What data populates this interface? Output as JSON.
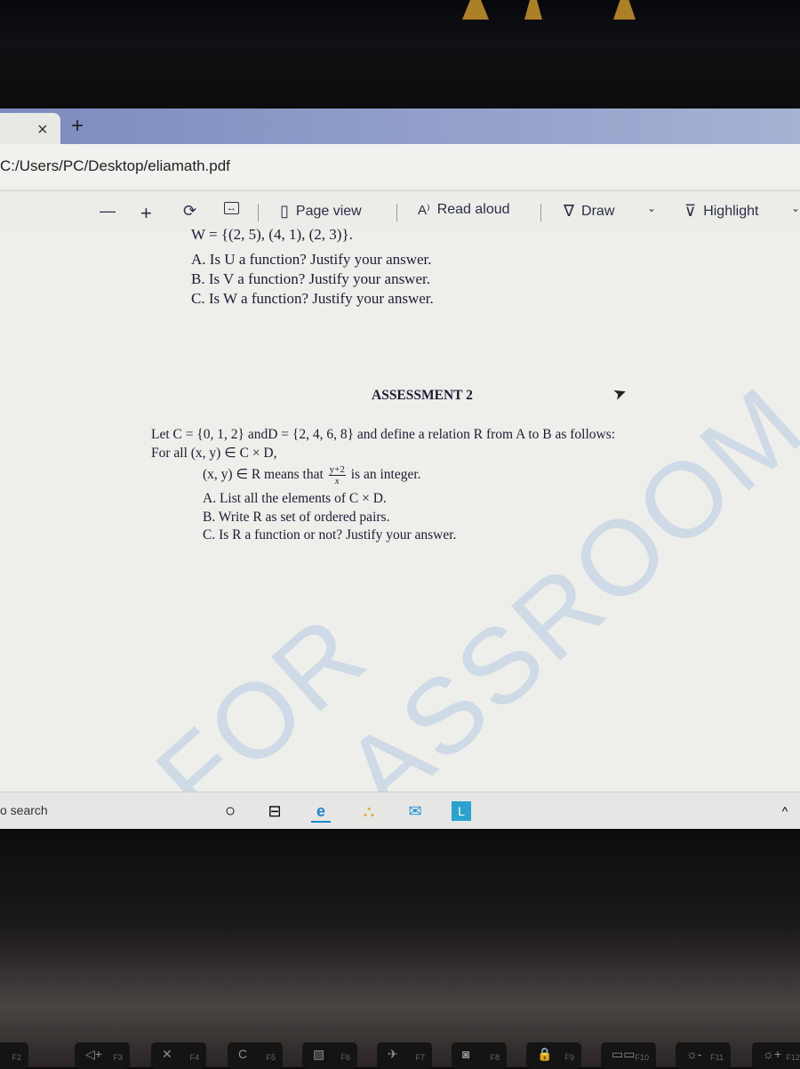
{
  "browser": {
    "tab_close": "×",
    "new_tab": "+",
    "address": "C:/Users/PC/Desktop/eliamath.pdf"
  },
  "toolbar": {
    "zoom_out": "—",
    "zoom_in": "+",
    "rotate_icon": "⟳",
    "fit_icon": "↔",
    "page_view": "Page view",
    "read_aloud": "Read aloud",
    "draw": "Draw",
    "highlight": "Highlight",
    "chevron": "⌄"
  },
  "document": {
    "prev_line": "W = {(2, 5), (4, 1), (2, 3)}.",
    "prev_questions": [
      "A. Is U a function? Justify your answer.",
      "B. Is V a function? Justify your answer.",
      "C. Is W a function? Justify your answer."
    ],
    "heading": "ASSESSMENT 2",
    "intro": "Let C = {0, 1, 2} andD = {2, 4, 6, 8} and define a relation R from A to B as follows:",
    "for_all": "For all (x, y) ∈ C × D,",
    "relation_prefix": "(x, y) ∈ R means that",
    "frac_num": "y+2",
    "frac_den": "x",
    "relation_suffix": "is an integer.",
    "questions": [
      "A. List all the elements of  C × D.",
      "B. Write R as set of ordered pairs.",
      "C. Is R a function or not? Justify your answer."
    ],
    "watermark": "FOR CLASSROOM USE"
  },
  "taskbar": {
    "search": "o search",
    "chevron": "^"
  },
  "keyboard": [
    {
      "glyph": "◁-",
      "fn": "F2"
    },
    {
      "glyph": "◁+",
      "fn": "F3"
    },
    {
      "glyph": "✕",
      "fn": "F4"
    },
    {
      "glyph": "C",
      "fn": "F5"
    },
    {
      "glyph": "▧",
      "fn": "F6"
    },
    {
      "glyph": "✈",
      "fn": "F7"
    },
    {
      "glyph": "◙",
      "fn": "F8"
    },
    {
      "glyph": "🔒",
      "fn": "F9"
    },
    {
      "glyph": "▭▭",
      "fn": "F10"
    },
    {
      "glyph": "☼-",
      "fn": "F11"
    },
    {
      "glyph": "☼+",
      "fn": "F12"
    }
  ]
}
